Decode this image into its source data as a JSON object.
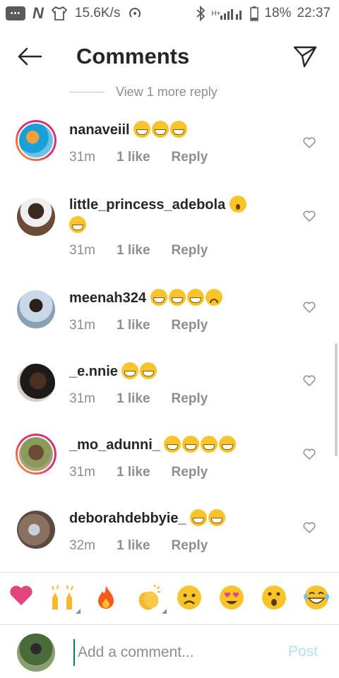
{
  "status_bar": {
    "speed": "15.6K/s",
    "network_label": "H+",
    "battery": "18%",
    "time": "22:37"
  },
  "header": {
    "title": "Comments"
  },
  "view_more": {
    "label": "View 1 more reply"
  },
  "comments": [
    {
      "username": "nanaveiil",
      "emojis": [
        "laugh",
        "laugh",
        "laugh"
      ],
      "time": "31m",
      "likes": "1 like",
      "reply": "Reply",
      "story_ring": true
    },
    {
      "username": "little_princess_adebola",
      "emojis": [
        "wow",
        "smile"
      ],
      "time": "31m",
      "likes": "1 like",
      "reply": "Reply",
      "story_ring": false
    },
    {
      "username": "meenah324",
      "emojis": [
        "laugh",
        "laugh",
        "laugh",
        "sad"
      ],
      "time": "31m",
      "likes": "1 like",
      "reply": "Reply",
      "story_ring": false
    },
    {
      "username": "_e.nnie",
      "emojis": [
        "laugh",
        "laugh"
      ],
      "time": "31m",
      "likes": "1 like",
      "reply": "Reply",
      "story_ring": false
    },
    {
      "username": "_mo_adunni_",
      "emojis": [
        "laugh",
        "laugh",
        "laugh",
        "laugh"
      ],
      "time": "31m",
      "likes": "1 like",
      "reply": "Reply",
      "story_ring": true
    },
    {
      "username": "deborahdebbyie_",
      "emojis": [
        "laugh",
        "laugh"
      ],
      "time": "32m",
      "likes": "1 like",
      "reply": "Reply",
      "story_ring": false
    }
  ],
  "reactions": [
    "heart",
    "raised-hands",
    "fire",
    "clapping-hands",
    "sad-face",
    "heart-eyes-face",
    "surprised-face",
    "laughing-face"
  ],
  "input": {
    "placeholder": "Add a comment...",
    "value": "",
    "post_label": "Post"
  },
  "colors": {
    "text": "#262626",
    "muted": "#8e8e8e",
    "post_disabled": "#b2dffc",
    "divider": "#dbdbdb"
  }
}
